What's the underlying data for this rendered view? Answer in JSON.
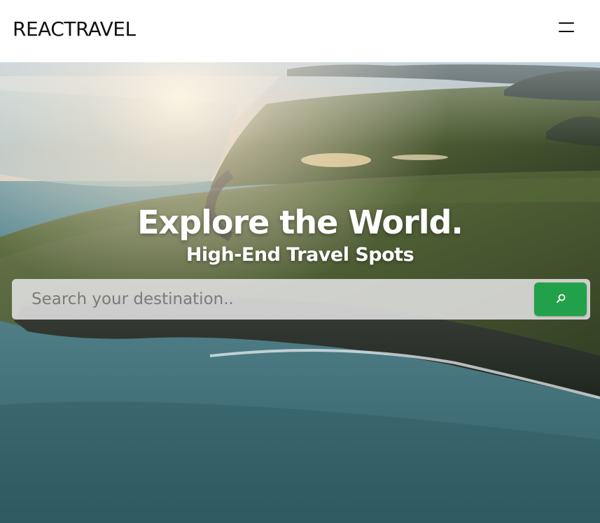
{
  "navbar": {
    "brand": "REACTRAVEL",
    "menu_icon": "hamburger-menu-icon"
  },
  "hero": {
    "title": "Explore the World.",
    "subtitle": "High-End Travel Spots",
    "background": "aerial-coastline-photo"
  },
  "search": {
    "placeholder": "Search your destination..",
    "value": "",
    "button_icon": "search-icon"
  },
  "colors": {
    "accent": "#23a04a",
    "nav_background": "#ffffff",
    "brand_text": "#111111"
  }
}
